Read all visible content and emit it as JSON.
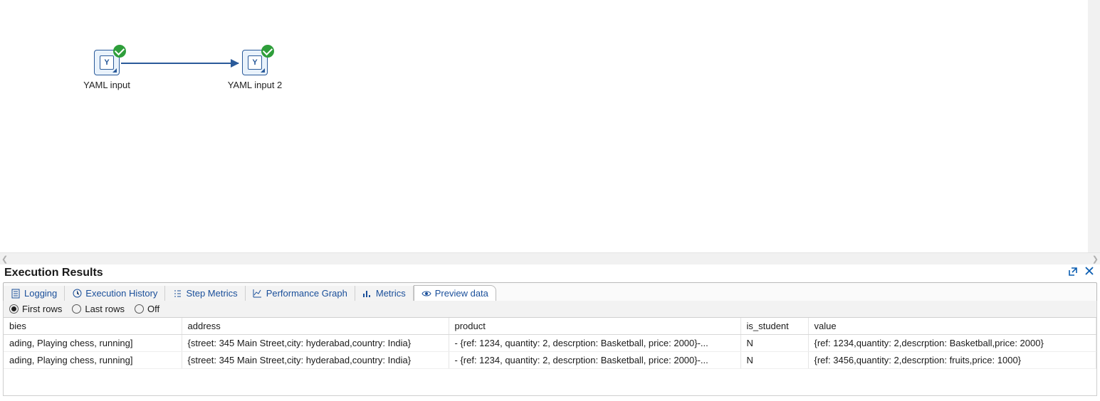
{
  "canvas": {
    "nodes": [
      {
        "label": "YAML input",
        "glyph": "Y"
      },
      {
        "label": "YAML input  2",
        "glyph": "Y"
      }
    ]
  },
  "panel": {
    "title": "Execution Results",
    "tabs": [
      {
        "label": "Logging"
      },
      {
        "label": "Execution History"
      },
      {
        "label": "Step Metrics"
      },
      {
        "label": "Performance Graph"
      },
      {
        "label": "Metrics"
      },
      {
        "label": "Preview data"
      }
    ],
    "row_mode": {
      "options": [
        "First rows",
        "Last rows",
        "Off"
      ],
      "selected": "First rows"
    }
  },
  "preview": {
    "columns": [
      "bies",
      "address",
      "product",
      "is_student",
      "value"
    ],
    "rows": [
      {
        "bies": "ading, Playing chess, running]",
        "address": "{street:  345 Main Street,city:  hyderabad,country:  India}",
        "product": "- {ref: 1234, quantity: 2, descrption: Basketball, price: 2000}-...",
        "is_student": "N",
        "value": "{ref:  1234,quantity:  2,descrption:  Basketball,price:  2000}"
      },
      {
        "bies": "ading, Playing chess, running]",
        "address": "{street:  345 Main Street,city:  hyderabad,country:  India}",
        "product": "- {ref: 1234, quantity: 2, descrption: Basketball, price: 2000}-...",
        "is_student": "N",
        "value": "{ref:  3456,quantity:  2,descrption:  fruits,price:  1000}"
      }
    ]
  }
}
